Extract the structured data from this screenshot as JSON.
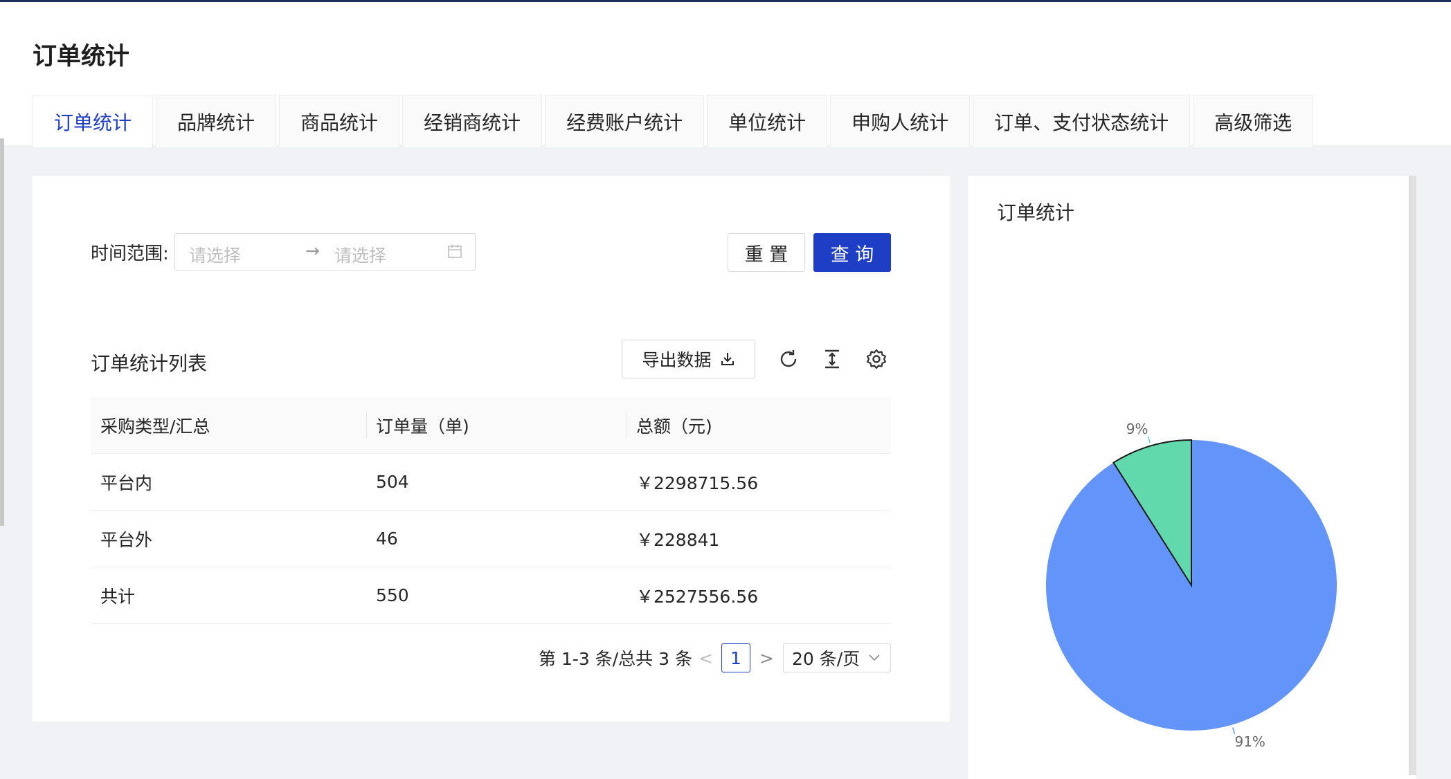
{
  "page": {
    "title": "订单统计"
  },
  "tabs": [
    {
      "label": "订单统计",
      "active": true
    },
    {
      "label": "品牌统计"
    },
    {
      "label": "商品统计"
    },
    {
      "label": "经销商统计"
    },
    {
      "label": "经费账户统计"
    },
    {
      "label": "单位统计"
    },
    {
      "label": "申购人统计"
    },
    {
      "label": "订单、支付状态统计"
    },
    {
      "label": "高级筛选"
    }
  ],
  "filter": {
    "label": "时间范围:",
    "start_placeholder": "请选择",
    "end_placeholder": "请选择",
    "arrow": "→",
    "reset_label": "重 置",
    "query_label": "查 询"
  },
  "list": {
    "title": "订单统计列表",
    "export_label": "导出数据",
    "columns": [
      "采购类型/汇总",
      "订单量（单)",
      "总额（元)"
    ],
    "rows": [
      [
        "平台内",
        "504",
        "￥2298715.56"
      ],
      [
        "平台外",
        "46",
        "￥228841"
      ],
      [
        "共计",
        "550",
        "￥2527556.56"
      ]
    ]
  },
  "pagination": {
    "total_text": "第 1-3 条/总共 3 条",
    "prev": "<",
    "current": "1",
    "next": ">",
    "page_size": "20 条/页"
  },
  "chart": {
    "title": "订单统计"
  },
  "chart_data": {
    "type": "pie",
    "title": "订单统计",
    "slices": [
      {
        "value": 91,
        "label": "91%",
        "color": "#6294f9"
      },
      {
        "value": 9,
        "label": "9%",
        "color": "#62d9ac"
      }
    ]
  },
  "colors": {
    "primary": "#1e3ec6",
    "pie_blue": "#6294f9",
    "pie_green": "#62d9ac"
  }
}
